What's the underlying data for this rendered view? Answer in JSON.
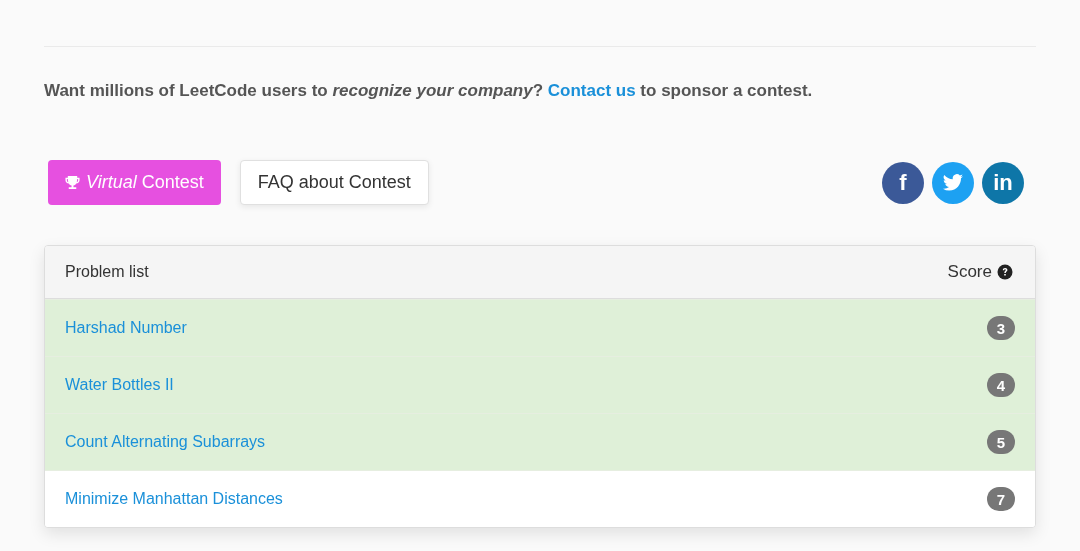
{
  "sponsor": {
    "before": "Want millions of LeetCode users to *recognize your company*? ",
    "link": "Contact us",
    "after": " to sponsor a contest."
  },
  "buttons": [
    {
      "kind": "virtual",
      "label": "*Virtual* Contest"
    },
    {
      "kind": "plain",
      "label": "FAQ about Contest"
    }
  ],
  "social": [
    {
      "kind": "facebook",
      "glyph": "f",
      "color": "#3b5998"
    },
    {
      "kind": "twitter",
      "color": "#1da1f2"
    },
    {
      "kind": "linkedin",
      "glyph": "in",
      "color": "#0e76a8"
    }
  ],
  "table": {
    "columns": [
      "Problem list",
      "Score"
    ],
    "rows": [
      {
        "title": "Harshad Number",
        "score": "3",
        "solved": true
      },
      {
        "title": "Water Bottles II",
        "score": "4",
        "solved": true
      },
      {
        "title": "Count Alternating Subarrays",
        "score": "5",
        "solved": true
      },
      {
        "title": "Minimize Manhattan Distances",
        "score": "7",
        "solved": false
      }
    ]
  }
}
